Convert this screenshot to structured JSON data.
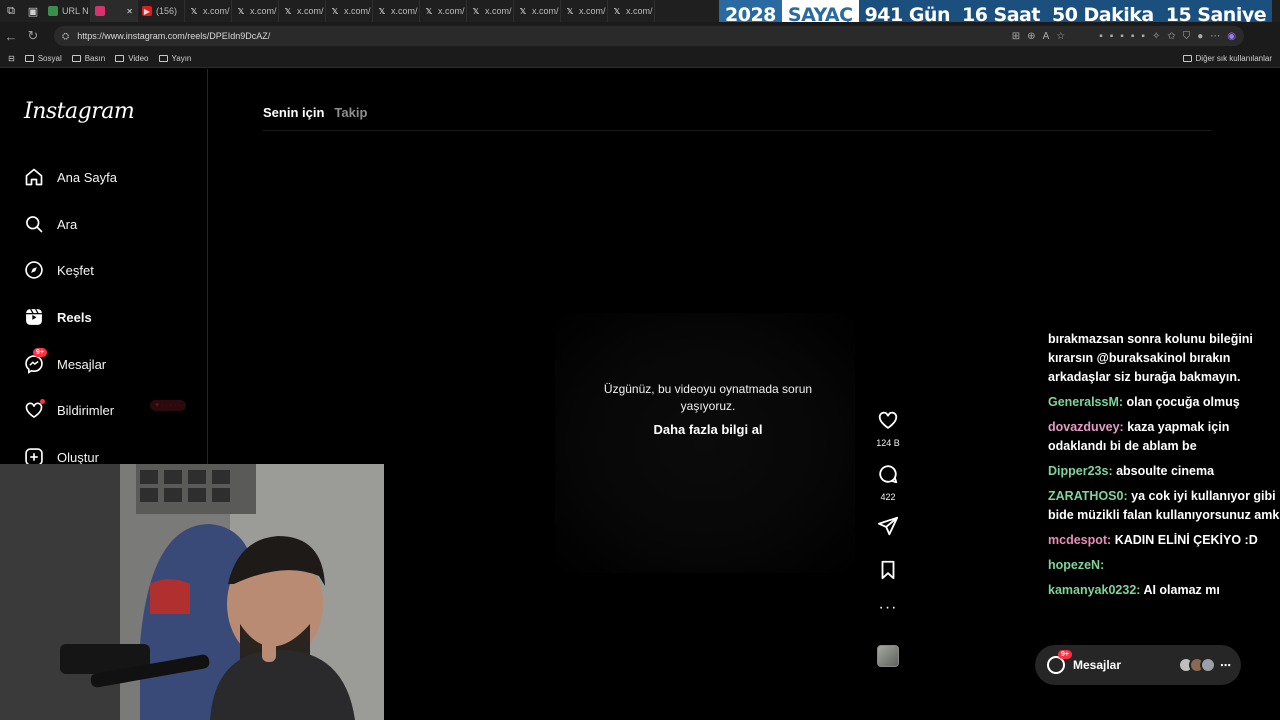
{
  "browser": {
    "tabs": [
      {
        "label": "URL N",
        "favicon": "url-icon"
      },
      {
        "label": "",
        "favicon": "instagram-icon",
        "active": true
      },
      {
        "label": "(156)",
        "favicon": "youtube-icon"
      },
      {
        "label": "x.com/",
        "favicon": "x-icon"
      },
      {
        "label": "x.com/",
        "favicon": "x-icon"
      },
      {
        "label": "x.com/",
        "favicon": "x-icon"
      },
      {
        "label": "x.com/",
        "favicon": "x-icon"
      },
      {
        "label": "x.com/",
        "favicon": "x-icon"
      },
      {
        "label": "x.com/",
        "favicon": "x-icon"
      },
      {
        "label": "x.com/",
        "favicon": "x-icon"
      },
      {
        "label": "x.com/",
        "favicon": "x-icon"
      },
      {
        "label": "x.com/",
        "favicon": "x-icon"
      },
      {
        "label": "x.com/",
        "favicon": "x-icon"
      }
    ],
    "url": "https://www.instagram.com/reels/DPEIdn9DcAZ/",
    "bookmarks": [
      "Sosyal",
      "Basın",
      "Video",
      "Yayın"
    ],
    "bookmarks_right": "Diğer sık kullanılanlar"
  },
  "countdown": {
    "year": "2028",
    "label": "SAYAÇ",
    "days": "941 Gün",
    "hours": "16 Saat",
    "minutes": "50 Dakika",
    "seconds": "15 Saniye"
  },
  "instagram": {
    "logo": "Instagram",
    "nav": [
      {
        "label": "Ana Sayfa",
        "icon": "home-icon"
      },
      {
        "label": "Ara",
        "icon": "search-icon"
      },
      {
        "label": "Keşfet",
        "icon": "explore-icon"
      },
      {
        "label": "Reels",
        "icon": "reels-icon"
      },
      {
        "label": "Mesajlar",
        "icon": "messenger-icon",
        "badge": "9+"
      },
      {
        "label": "Bildirimler",
        "icon": "heart-icon"
      },
      {
        "label": "Oluştur",
        "icon": "plus-icon"
      }
    ],
    "tabs": {
      "active": "Senin için",
      "inactive": "Takip"
    },
    "error_text": "Üzgünüz, bu videoyu oynatmada sorun yaşıyoruz.",
    "learn_more": "Daha fazla bilgi al",
    "likes": "124 B",
    "comments": "422",
    "messages_bar": {
      "label": "Mesajlar",
      "badge": "9+"
    }
  },
  "chat": [
    {
      "user": "",
      "text": "bırakmazsan sonra kolunu bileğini kırarsın @buraksakinol bırakın arkadaşlar siz burağa bakmayın."
    },
    {
      "user": "GeneralssM:",
      "text": "olan çocuğa olmuş",
      "color": "green"
    },
    {
      "user": "dovazduvey:",
      "text": "kaza yapmak için odaklandı bi de ablam be",
      "color": "pink"
    },
    {
      "user": "Dipper23s:",
      "text": "absoulte cinema",
      "color": "green"
    },
    {
      "user": "ZARATHOS0:",
      "text": "ya cok iyi kullanıyor gibi bide müzikli falan kullanıyorsunuz amk",
      "color": "green"
    },
    {
      "user": "mcdespot:",
      "text": "KADIN ELİNİ ÇEKİYO :D",
      "color": "dpink"
    },
    {
      "user": "hopezeN:",
      "text": "",
      "color": "green"
    },
    {
      "user": "kamanyak0232:",
      "text": "AI olamaz mı",
      "color": "green"
    }
  ],
  "colors": {
    "countdown_blue": "#1a4f7e",
    "notification_red": "#ff3040",
    "chat_green": "#7fd49a",
    "chat_pink": "#e59ac5"
  }
}
